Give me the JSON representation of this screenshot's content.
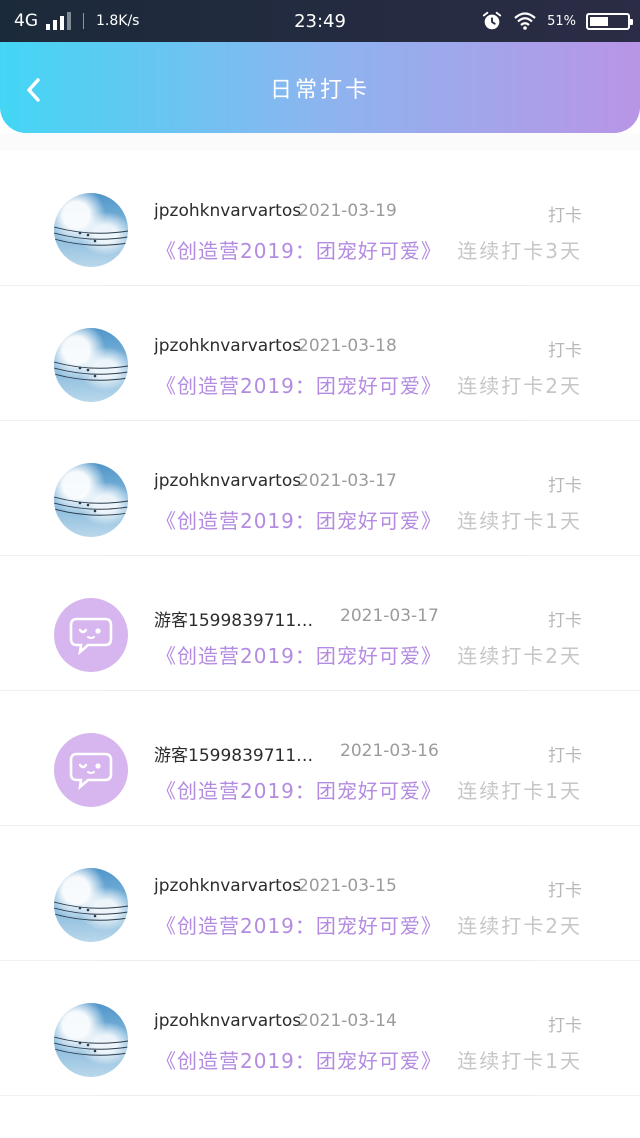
{
  "status_bar": {
    "network": "4G",
    "speed": "1.8K/s",
    "time": "23:49",
    "battery": "51%",
    "battery_level": 0.51
  },
  "header": {
    "title": "日常打卡",
    "gradient_colors": [
      "#43d6f4",
      "#8cb5ef",
      "#b995e6"
    ]
  },
  "colors": {
    "topic": "#b38be0",
    "guest_avatar": "#d7b6ef"
  },
  "items": [
    {
      "avatar": "sky-avatar",
      "user": "jpzohknvarvartos",
      "date": "2021-03-19",
      "action": "打卡",
      "topic": "《创造营2019：团宠好可爱》",
      "streak": "连续打卡3天"
    },
    {
      "avatar": "sky-avatar",
      "user": "jpzohknvarvartos",
      "date": "2021-03-18",
      "action": "打卡",
      "topic": "《创造营2019：团宠好可爱》",
      "streak": "连续打卡2天"
    },
    {
      "avatar": "sky-avatar",
      "user": "jpzohknvarvartos",
      "date": "2021-03-17",
      "action": "打卡",
      "topic": "《创造营2019：团宠好可爱》",
      "streak": "连续打卡1天"
    },
    {
      "avatar": "guest-avatar",
      "user": "游客1599839711…",
      "date": "2021-03-17",
      "action": "打卡",
      "topic": "《创造营2019：团宠好可爱》",
      "streak": "连续打卡2天"
    },
    {
      "avatar": "guest-avatar",
      "user": "游客1599839711…",
      "date": "2021-03-16",
      "action": "打卡",
      "topic": "《创造营2019：团宠好可爱》",
      "streak": "连续打卡1天"
    },
    {
      "avatar": "sky-avatar",
      "user": "jpzohknvarvartos",
      "date": "2021-03-15",
      "action": "打卡",
      "topic": "《创造营2019：团宠好可爱》",
      "streak": "连续打卡2天"
    },
    {
      "avatar": "sky-avatar",
      "user": "jpzohknvarvartos",
      "date": "2021-03-14",
      "action": "打卡",
      "topic": "《创造营2019：团宠好可爱》",
      "streak": "连续打卡1天"
    }
  ]
}
